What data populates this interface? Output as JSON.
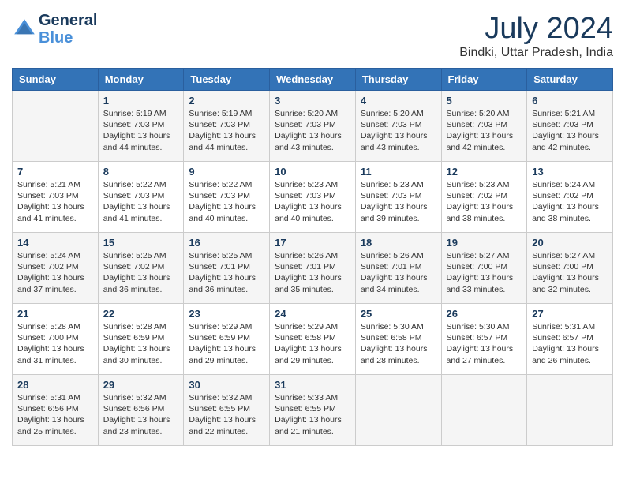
{
  "header": {
    "logo_line1": "General",
    "logo_line2": "Blue",
    "month_title": "July 2024",
    "location": "Bindki, Uttar Pradesh, India"
  },
  "weekdays": [
    "Sunday",
    "Monday",
    "Tuesday",
    "Wednesday",
    "Thursday",
    "Friday",
    "Saturday"
  ],
  "weeks": [
    [
      {
        "day": "",
        "content": ""
      },
      {
        "day": "1",
        "content": "Sunrise: 5:19 AM\nSunset: 7:03 PM\nDaylight: 13 hours\nand 44 minutes."
      },
      {
        "day": "2",
        "content": "Sunrise: 5:19 AM\nSunset: 7:03 PM\nDaylight: 13 hours\nand 44 minutes."
      },
      {
        "day": "3",
        "content": "Sunrise: 5:20 AM\nSunset: 7:03 PM\nDaylight: 13 hours\nand 43 minutes."
      },
      {
        "day": "4",
        "content": "Sunrise: 5:20 AM\nSunset: 7:03 PM\nDaylight: 13 hours\nand 43 minutes."
      },
      {
        "day": "5",
        "content": "Sunrise: 5:20 AM\nSunset: 7:03 PM\nDaylight: 13 hours\nand 42 minutes."
      },
      {
        "day": "6",
        "content": "Sunrise: 5:21 AM\nSunset: 7:03 PM\nDaylight: 13 hours\nand 42 minutes."
      }
    ],
    [
      {
        "day": "7",
        "content": "Sunrise: 5:21 AM\nSunset: 7:03 PM\nDaylight: 13 hours\nand 41 minutes."
      },
      {
        "day": "8",
        "content": "Sunrise: 5:22 AM\nSunset: 7:03 PM\nDaylight: 13 hours\nand 41 minutes."
      },
      {
        "day": "9",
        "content": "Sunrise: 5:22 AM\nSunset: 7:03 PM\nDaylight: 13 hours\nand 40 minutes."
      },
      {
        "day": "10",
        "content": "Sunrise: 5:23 AM\nSunset: 7:03 PM\nDaylight: 13 hours\nand 40 minutes."
      },
      {
        "day": "11",
        "content": "Sunrise: 5:23 AM\nSunset: 7:03 PM\nDaylight: 13 hours\nand 39 minutes."
      },
      {
        "day": "12",
        "content": "Sunrise: 5:23 AM\nSunset: 7:02 PM\nDaylight: 13 hours\nand 38 minutes."
      },
      {
        "day": "13",
        "content": "Sunrise: 5:24 AM\nSunset: 7:02 PM\nDaylight: 13 hours\nand 38 minutes."
      }
    ],
    [
      {
        "day": "14",
        "content": "Sunrise: 5:24 AM\nSunset: 7:02 PM\nDaylight: 13 hours\nand 37 minutes."
      },
      {
        "day": "15",
        "content": "Sunrise: 5:25 AM\nSunset: 7:02 PM\nDaylight: 13 hours\nand 36 minutes."
      },
      {
        "day": "16",
        "content": "Sunrise: 5:25 AM\nSunset: 7:01 PM\nDaylight: 13 hours\nand 36 minutes."
      },
      {
        "day": "17",
        "content": "Sunrise: 5:26 AM\nSunset: 7:01 PM\nDaylight: 13 hours\nand 35 minutes."
      },
      {
        "day": "18",
        "content": "Sunrise: 5:26 AM\nSunset: 7:01 PM\nDaylight: 13 hours\nand 34 minutes."
      },
      {
        "day": "19",
        "content": "Sunrise: 5:27 AM\nSunset: 7:00 PM\nDaylight: 13 hours\nand 33 minutes."
      },
      {
        "day": "20",
        "content": "Sunrise: 5:27 AM\nSunset: 7:00 PM\nDaylight: 13 hours\nand 32 minutes."
      }
    ],
    [
      {
        "day": "21",
        "content": "Sunrise: 5:28 AM\nSunset: 7:00 PM\nDaylight: 13 hours\nand 31 minutes."
      },
      {
        "day": "22",
        "content": "Sunrise: 5:28 AM\nSunset: 6:59 PM\nDaylight: 13 hours\nand 30 minutes."
      },
      {
        "day": "23",
        "content": "Sunrise: 5:29 AM\nSunset: 6:59 PM\nDaylight: 13 hours\nand 29 minutes."
      },
      {
        "day": "24",
        "content": "Sunrise: 5:29 AM\nSunset: 6:58 PM\nDaylight: 13 hours\nand 29 minutes."
      },
      {
        "day": "25",
        "content": "Sunrise: 5:30 AM\nSunset: 6:58 PM\nDaylight: 13 hours\nand 28 minutes."
      },
      {
        "day": "26",
        "content": "Sunrise: 5:30 AM\nSunset: 6:57 PM\nDaylight: 13 hours\nand 27 minutes."
      },
      {
        "day": "27",
        "content": "Sunrise: 5:31 AM\nSunset: 6:57 PM\nDaylight: 13 hours\nand 26 minutes."
      }
    ],
    [
      {
        "day": "28",
        "content": "Sunrise: 5:31 AM\nSunset: 6:56 PM\nDaylight: 13 hours\nand 25 minutes."
      },
      {
        "day": "29",
        "content": "Sunrise: 5:32 AM\nSunset: 6:56 PM\nDaylight: 13 hours\nand 23 minutes."
      },
      {
        "day": "30",
        "content": "Sunrise: 5:32 AM\nSunset: 6:55 PM\nDaylight: 13 hours\nand 22 minutes."
      },
      {
        "day": "31",
        "content": "Sunrise: 5:33 AM\nSunset: 6:55 PM\nDaylight: 13 hours\nand 21 minutes."
      },
      {
        "day": "",
        "content": ""
      },
      {
        "day": "",
        "content": ""
      },
      {
        "day": "",
        "content": ""
      }
    ]
  ]
}
